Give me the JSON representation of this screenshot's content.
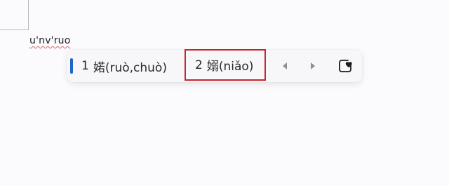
{
  "composition": {
    "text": "u'nv'ruo"
  },
  "candidates": [
    {
      "index": "1",
      "text": "婼(ruò,chuò)"
    },
    {
      "index": "2",
      "text": "嫋(niǎo)"
    }
  ],
  "icons": {
    "prev": "caret-left-icon",
    "next": "caret-right-icon",
    "favorite": "heart-box-icon"
  },
  "colors": {
    "caret": "#1f66c8",
    "highlight_border": "#c8252c",
    "underline": "#d26b6b"
  }
}
